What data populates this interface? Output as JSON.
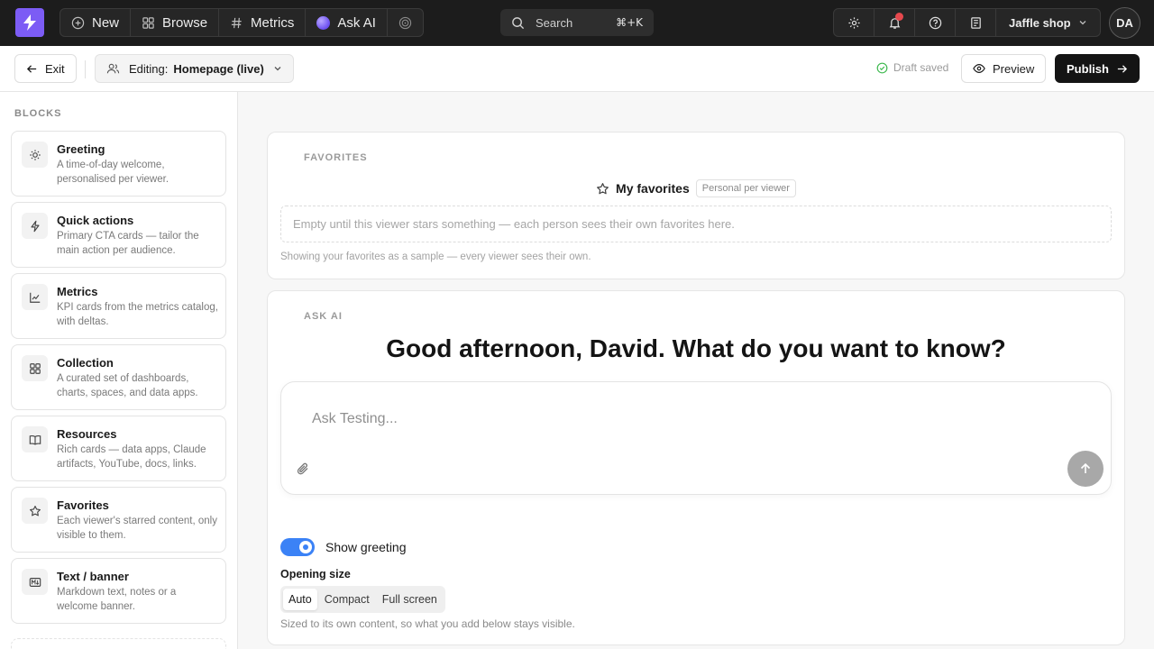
{
  "nav": {
    "new_label": "New",
    "browse_label": "Browse",
    "metrics_label": "Metrics",
    "ask_ai_label": "Ask AI"
  },
  "search": {
    "label": "Search",
    "shortcut": "⌘+K"
  },
  "workspace": {
    "name": "Jaffle shop"
  },
  "user": {
    "initials": "DA"
  },
  "editbar": {
    "exit_label": "Exit",
    "editing_prefix": "Editing:",
    "editing_target": "Homepage (live)",
    "draft_status": "Draft saved",
    "preview_label": "Preview",
    "publish_label": "Publish"
  },
  "sidebar": {
    "title": "BLOCKS",
    "items": [
      {
        "title": "Greeting",
        "desc": "A time-of-day welcome, personalised per viewer.",
        "icon": "sun-icon"
      },
      {
        "title": "Quick actions",
        "desc": "Primary CTA cards — tailor the main action per audience.",
        "icon": "lightning-icon"
      },
      {
        "title": "Metrics",
        "desc": "KPI cards from the metrics catalog, with deltas.",
        "icon": "chart-icon"
      },
      {
        "title": "Collection",
        "desc": "A curated set of dashboards, charts, spaces, and data apps.",
        "icon": "grid-icon"
      },
      {
        "title": "Resources",
        "desc": "Rich cards — data apps, Claude artifacts, YouTube, docs, links.",
        "icon": "book-icon"
      },
      {
        "title": "Favorites",
        "desc": "Each viewer's starred content, only visible to them.",
        "icon": "star-icon"
      },
      {
        "title": "Text / banner",
        "desc": "Markdown text, notes or a welcome banner.",
        "icon": "markdown-icon"
      }
    ]
  },
  "favorites": {
    "label": "FAVORITES",
    "title": "My favorites",
    "chip": "Personal per viewer",
    "empty": "Empty until this viewer stars something — each person sees their own favorites here.",
    "note": "Showing your favorites as a sample — every viewer sees their own."
  },
  "ask_ai": {
    "label": "ASK AI",
    "greeting": "Good afternoon, David. What do you want to know?",
    "placeholder": "Ask Testing...",
    "show_greeting_label": "Show greeting",
    "show_greeting_on": true,
    "opening_size_label": "Opening size",
    "size_options": [
      "Auto",
      "Compact",
      "Full screen"
    ],
    "size_selected": "Auto",
    "size_note": "Sized to its own content, so what you add below stays visible."
  },
  "colors": {
    "brand": "#7c5cf5",
    "toggle": "#3b82f6",
    "notification": "#e5484d",
    "draft_ok": "#3fb950"
  }
}
